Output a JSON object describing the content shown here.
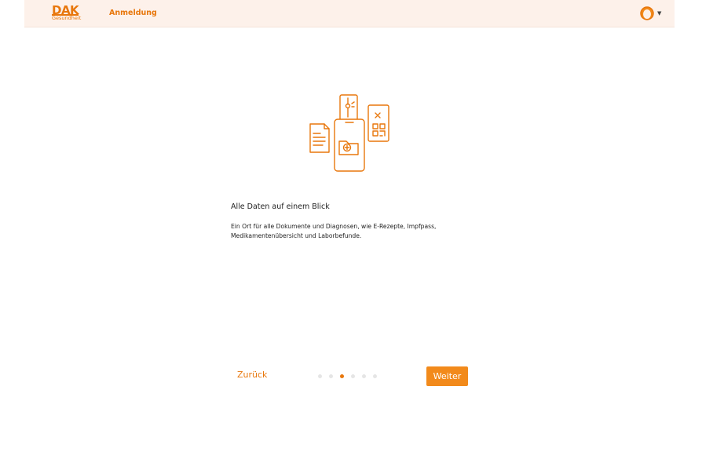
{
  "header": {
    "logo_text": "DAK",
    "logo_sub": "Gesundheit",
    "title": "Anmeldung"
  },
  "content": {
    "title": "Alle Daten auf einem Blick",
    "description": "Ein Ort für alle Dokumente und Diagnosen, wie E-Rezepte, Impfpass, Medikamentenübersicht und Laborbefunde."
  },
  "nav": {
    "back_label": "Zurück",
    "next_label": "Weiter",
    "page_count": 6,
    "active_page": 3
  },
  "icons": {
    "user": "user-avatar-icon",
    "chevron": "chevron-down-icon",
    "illustration": "health-documents-illustration"
  },
  "colors": {
    "accent": "#e8770c",
    "button": "#f28a1b",
    "header_bg": "#fdf1ea"
  }
}
